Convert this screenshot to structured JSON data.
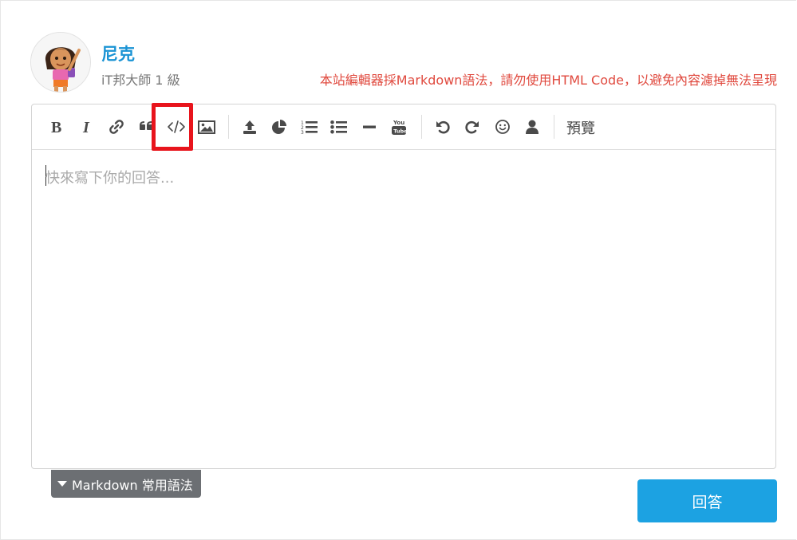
{
  "user": {
    "name": "尼克",
    "rank": "iT邦大師 1 級"
  },
  "notice": "本站編輯器採Markdown語法，請勿使用HTML Code，以避免內容濾掉無法呈現",
  "toolbar": {
    "buttons": [
      {
        "icon": "bold-icon"
      },
      {
        "icon": "italic-icon"
      },
      {
        "icon": "link-icon"
      },
      {
        "icon": "quote-icon"
      },
      {
        "icon": "code-icon",
        "highlighted": true
      },
      {
        "icon": "image-icon"
      },
      {
        "icon": "upload-icon"
      },
      {
        "icon": "pie-chart-icon"
      },
      {
        "icon": "ordered-list-icon"
      },
      {
        "icon": "unordered-list-icon"
      },
      {
        "icon": "horizontal-rule-icon"
      },
      {
        "icon": "youtube-icon"
      },
      {
        "icon": "undo-icon"
      },
      {
        "icon": "redo-icon"
      },
      {
        "icon": "emoji-icon"
      },
      {
        "icon": "user-mention-icon"
      }
    ],
    "preview_label": "預覽",
    "highlight_color": "#e8141c"
  },
  "editor": {
    "placeholder": "快來寫下你的回答...",
    "value": ""
  },
  "markdown_help": {
    "label": "Markdown 常用語法"
  },
  "submit": {
    "label": "回答",
    "color": "#1ca2e2"
  },
  "colors": {
    "username": "#1a93d4",
    "notice": "#e04a3f",
    "toolbar_icon": "#4a4a4a"
  }
}
